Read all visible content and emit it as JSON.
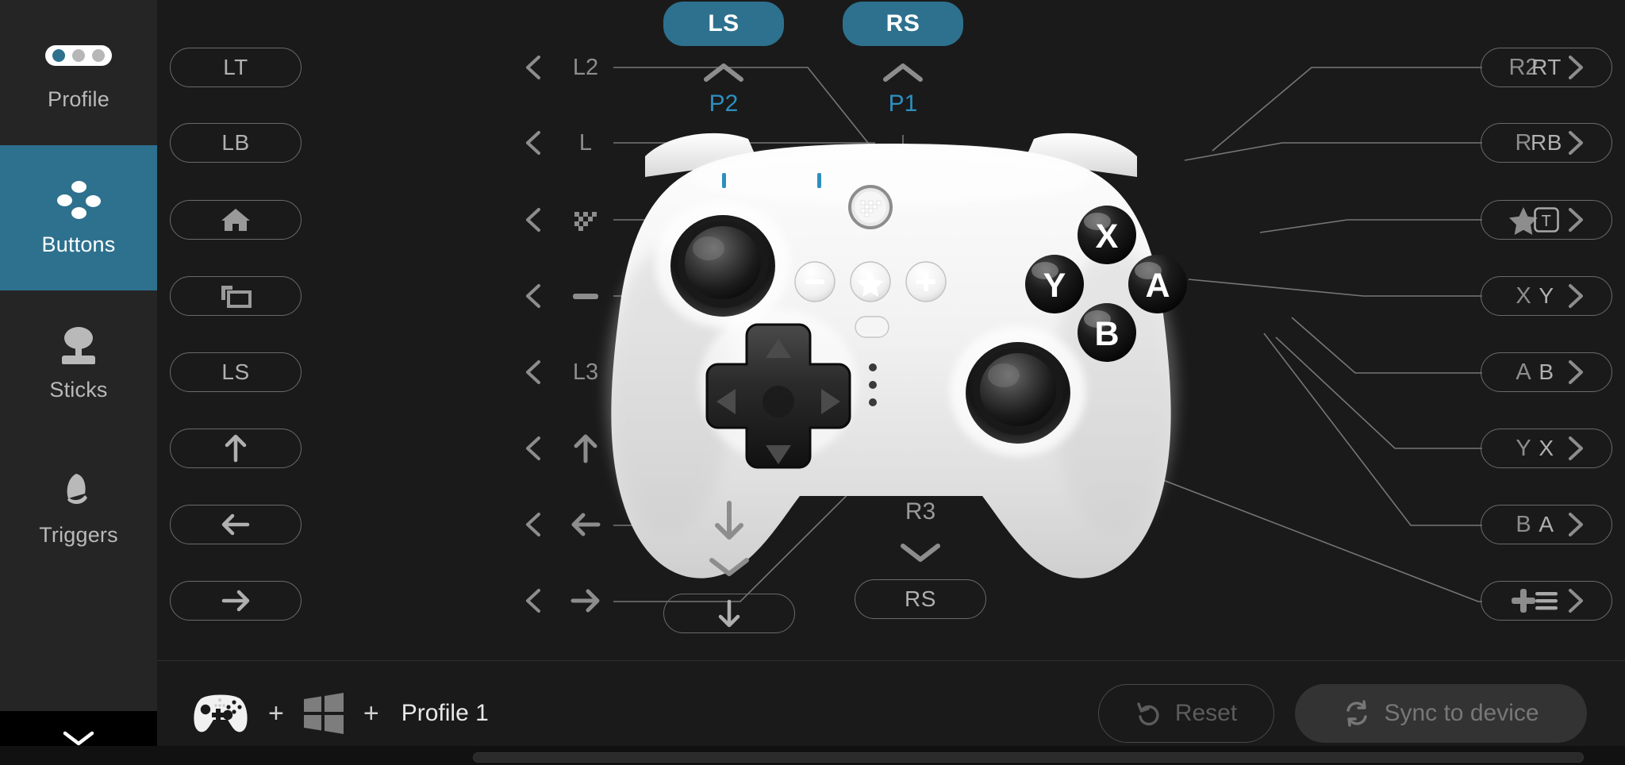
{
  "accent": "#2d718e",
  "accent_text": "#2d8fc0",
  "sidebar": {
    "items": [
      {
        "label": "Profile",
        "icon": "profile-dots-icon",
        "active": false
      },
      {
        "label": "Buttons",
        "icon": "dpad-dots-icon",
        "active": true
      },
      {
        "label": "Sticks",
        "icon": "joystick-icon",
        "active": false
      },
      {
        "label": "Triggers",
        "icon": "trigger-icon",
        "active": false
      }
    ],
    "collapse_icon": "chevron-down-icon"
  },
  "top_mappings": [
    {
      "target": "LS",
      "chevron": "chevron-up-icon",
      "source": "P2"
    },
    {
      "target": "RS",
      "chevron": "chevron-up-icon",
      "source": "P1"
    }
  ],
  "bottom_mappings": [
    {
      "source": "dpad-down-arrow",
      "chevron": "chevron-down-icon",
      "target": "down-arrow-icon"
    },
    {
      "source": "R3",
      "chevron": "chevron-down-icon",
      "target": "RS"
    }
  ],
  "left_mappings": [
    {
      "source": "L2",
      "source_icon": "",
      "chevron": "chevron-left-icon",
      "target": "LT",
      "target_icon": ""
    },
    {
      "source": "L",
      "source_icon": "",
      "chevron": "chevron-left-icon",
      "target": "LB",
      "target_icon": ""
    },
    {
      "source": "",
      "source_icon": "switch-home-icon",
      "chevron": "chevron-left-icon",
      "target": "",
      "target_icon": "home-icon"
    },
    {
      "source": "",
      "source_icon": "minus-icon",
      "chevron": "chevron-left-icon",
      "target": "",
      "target_icon": "window-copy-icon"
    },
    {
      "source": "L3",
      "source_icon": "",
      "chevron": "chevron-left-icon",
      "target": "LS",
      "target_icon": ""
    },
    {
      "source": "",
      "source_icon": "arrow-up-icon",
      "chevron": "chevron-left-icon",
      "target": "",
      "target_icon": "arrow-up-icon"
    },
    {
      "source": "",
      "source_icon": "arrow-left-icon",
      "chevron": "chevron-left-icon",
      "target": "",
      "target_icon": "arrow-left-icon"
    },
    {
      "source": "",
      "source_icon": "arrow-right-icon",
      "chevron": "chevron-left-icon",
      "target": "",
      "target_icon": "arrow-right-icon"
    }
  ],
  "right_mappings": [
    {
      "source": "R2",
      "source_icon": "",
      "chevron": "chevron-right-icon",
      "target": "RT",
      "target_icon": ""
    },
    {
      "source": "R",
      "source_icon": "",
      "chevron": "chevron-right-icon",
      "target": "RB",
      "target_icon": ""
    },
    {
      "source": "",
      "source_icon": "star-icon",
      "chevron": "chevron-right-icon",
      "target": "",
      "target_icon": "boxed-t-icon"
    },
    {
      "source": "X",
      "source_icon": "",
      "chevron": "chevron-right-icon",
      "target": "Y",
      "target_icon": ""
    },
    {
      "source": "A",
      "source_icon": "",
      "chevron": "chevron-right-icon",
      "target": "B",
      "target_icon": ""
    },
    {
      "source": "Y",
      "source_icon": "",
      "chevron": "chevron-right-icon",
      "target": "X",
      "target_icon": ""
    },
    {
      "source": "B",
      "source_icon": "",
      "chevron": "chevron-right-icon",
      "target": "A",
      "target_icon": ""
    },
    {
      "source": "",
      "source_icon": "plus-icon",
      "chevron": "chevron-right-icon",
      "target": "",
      "target_icon": "hamburger-icon"
    }
  ],
  "controller": {
    "face_buttons": [
      "X",
      "Y",
      "A",
      "B"
    ],
    "center_buttons": [
      "minus-icon",
      "star-icon",
      "plus-icon"
    ],
    "home_button": "switch-home-icon",
    "led_labels": [
      "P2",
      "P1"
    ]
  },
  "footer": {
    "device_icon": "gamepad-icon",
    "plus_1": "+",
    "platform_icon": "windows-icon",
    "plus_2": "+",
    "profile": "Profile 1",
    "reset_label": "Reset",
    "reset_icon": "undo-icon",
    "sync_label": "Sync to device",
    "sync_icon": "refresh-icon"
  }
}
